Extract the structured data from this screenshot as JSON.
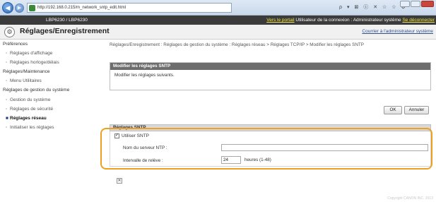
{
  "browser": {
    "url": "http://192.168.0.215/m_network_sntp_edit.html",
    "search_icons": [
      "ρ",
      "▾",
      "⊠",
      "ⓒ",
      "✕"
    ],
    "nav_icons": [
      "☆",
      "☆",
      "⚙"
    ]
  },
  "topbar": {
    "model": "LBP6230 / LBP6230",
    "portal_link": "Vers le portail",
    "login_text": "Utilisateur de la connexion : Administrateur système",
    "logout_link": "Se déconnecter"
  },
  "header": {
    "title": "Réglages/Enregistrement",
    "mail_link": "Courrier à l'administrateur système"
  },
  "sidebar": {
    "sections": [
      {
        "label": "Préférences",
        "items": [
          {
            "label": "Réglages d'affichage"
          },
          {
            "label": "Réglages horloge/délais"
          }
        ]
      },
      {
        "label": "Réglages/Maintenance",
        "items": [
          {
            "label": "Menu Utilitaires"
          }
        ]
      },
      {
        "label": "Réglages de gestion du système",
        "items": [
          {
            "label": "Gestion du système"
          },
          {
            "label": "Réglages de sécurité"
          },
          {
            "label": "Réglages réseau",
            "active": true
          },
          {
            "label": "Initialiser les réglages"
          }
        ]
      }
    ]
  },
  "main": {
    "breadcrumb": "Réglages/Enregistrement : Réglages de gestion du système : Réglages réseau > Réglages TCP/IP > Modifier les réglages SNTP",
    "panel_title": "Modifier les réglages SNTP",
    "panel_text": "Modifier les réglages suivants.",
    "ok_label": "OK",
    "cancel_label": "Annuler",
    "sntp": {
      "title": "Réglages SNTP",
      "use_sntp_label": "Utiliser SNTP",
      "use_sntp_checked": true,
      "ntp_server_label": "Nom du serveur NTP :",
      "ntp_server_value": "",
      "interval_label": "Intervalle de relève :",
      "interval_value": "24",
      "interval_unit": "heures (1-48)"
    }
  },
  "footer": {
    "copyright": "Copyright CANON INC. 2013"
  },
  "colors": {
    "highlight": "#f0a020",
    "topbar_bg": "#3b3b3b",
    "topbar_link": "#f5e64a",
    "panel_head": "#6d6d6d"
  }
}
